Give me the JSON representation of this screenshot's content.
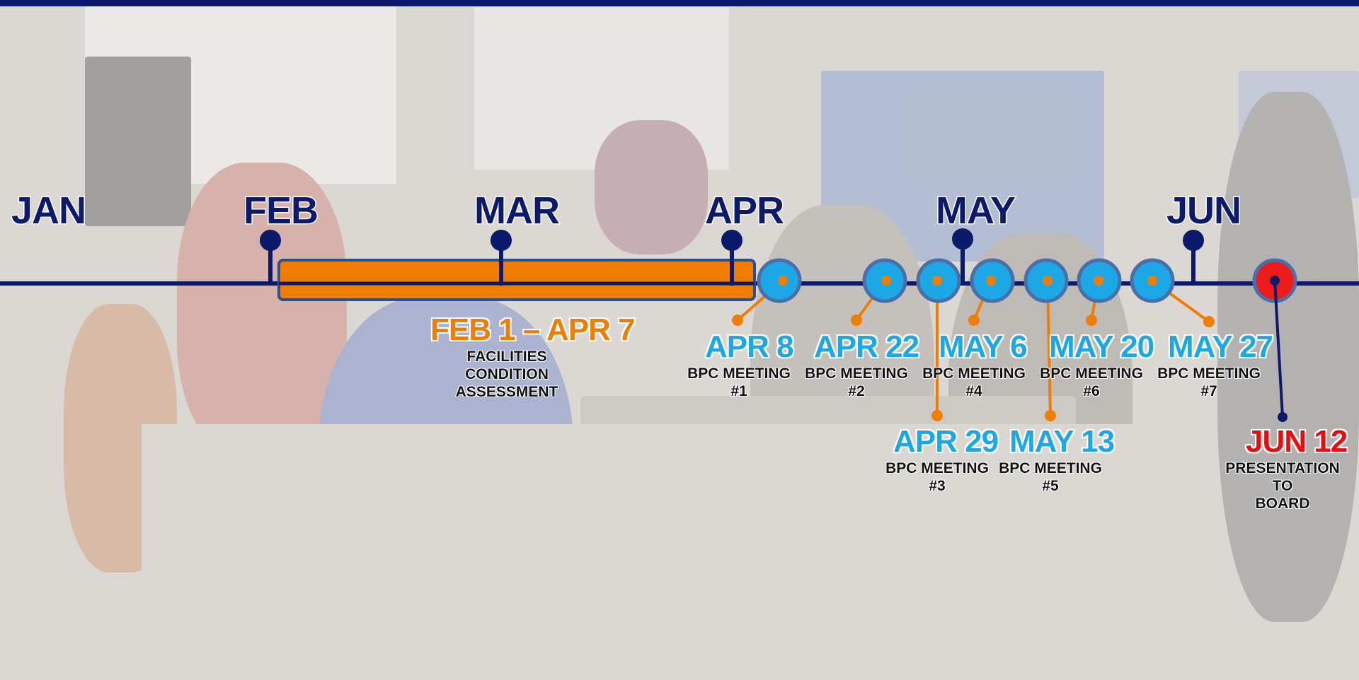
{
  "months": [
    "JAN",
    "FEB",
    "MAR",
    "APR",
    "MAY",
    "JUN"
  ],
  "range_event": {
    "date": "FEB 1 – APR 7",
    "lines": [
      "FACILITIES",
      "CONDITION",
      "ASSESSMENT"
    ]
  },
  "meetings": [
    {
      "date": "APR 8",
      "label": "BPC MEETING",
      "number": "#1"
    },
    {
      "date": "APR 22",
      "label": "BPC MEETING",
      "number": "#2"
    },
    {
      "date": "APR 29",
      "label": "BPC MEETING",
      "number": "#3"
    },
    {
      "date": "MAY 6",
      "label": "BPC MEETING",
      "number": "#4"
    },
    {
      "date": "MAY 13",
      "label": "BPC MEETING",
      "number": "#5"
    },
    {
      "date": "MAY 20",
      "label": "BPC MEETING",
      "number": "#6"
    },
    {
      "date": "MAY 27",
      "label": "BPC MEETING",
      "number": "#7"
    }
  ],
  "final_event": {
    "date": "JUN 12",
    "lines": [
      "PRESENTATION",
      "TO",
      "BOARD"
    ]
  },
  "colors": {
    "navy": "#0b1a6b",
    "orange": "#ee7d00",
    "cyan": "#1ca8e6",
    "red": "#ee0a0a"
  }
}
